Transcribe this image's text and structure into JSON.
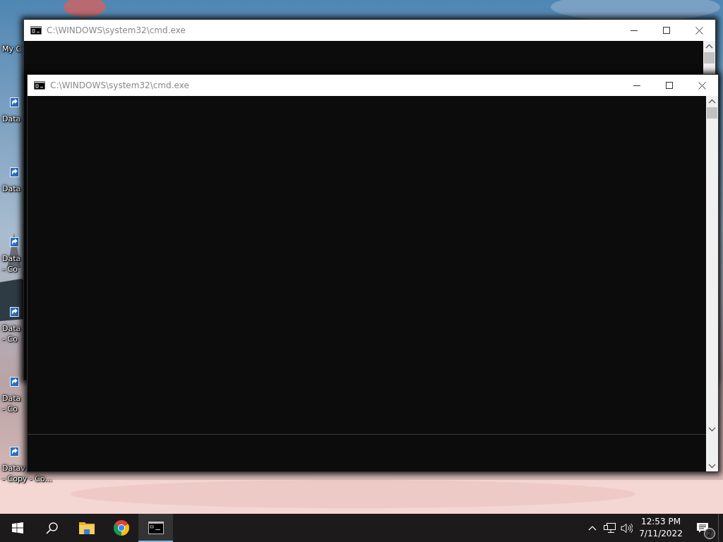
{
  "desktop_icons": [
    {
      "lines": [
        "My C"
      ],
      "shortcut": false
    },
    {
      "lines": [
        "Data"
      ],
      "shortcut": true
    },
    {
      "lines": [
        "Data"
      ],
      "shortcut": true
    },
    {
      "lines": [
        "Data",
        "- Co"
      ],
      "shortcut": true
    },
    {
      "lines": [
        "Data",
        "- Co"
      ],
      "shortcut": true
    },
    {
      "lines": [
        "Data",
        "- Co"
      ],
      "shortcut": true
    },
    {
      "lines": [
        "Datav",
        "- Copy - Co..."
      ],
      "shortcut": true
    }
  ],
  "windows": [
    {
      "title": "C:\\WINDOWS\\system32\\cmd.exe"
    },
    {
      "title": "C:\\WINDOWS\\system32\\cmd.exe"
    }
  ],
  "taskbar": {
    "apps": [
      {
        "kind": "start",
        "active": false
      },
      {
        "kind": "search",
        "active": false
      },
      {
        "kind": "folder",
        "active": false
      },
      {
        "kind": "browser",
        "active": false
      },
      {
        "kind": "console",
        "active": true
      }
    ],
    "time": "12:53 PM",
    "date": "7/11/2022",
    "notification_count": "2"
  }
}
